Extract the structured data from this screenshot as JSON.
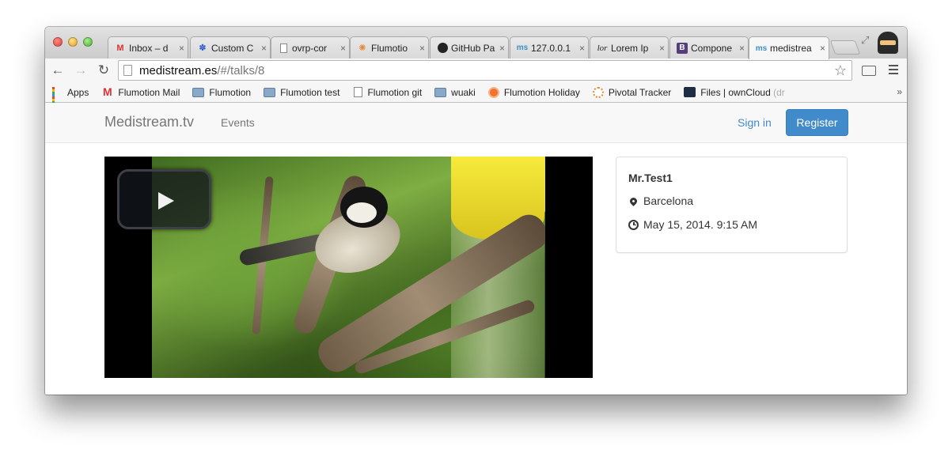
{
  "browser": {
    "tabs": [
      {
        "label": "Inbox – d",
        "favicon": "gmail-icon",
        "active": false
      },
      {
        "label": "Custom C",
        "favicon": "paw-icon",
        "active": false
      },
      {
        "label": "ovrp-cor",
        "favicon": "page-icon",
        "active": false
      },
      {
        "label": "Flumotio",
        "favicon": "pivotal-icon",
        "active": false
      },
      {
        "label": "GitHub Pa",
        "favicon": "github-icon",
        "active": false
      },
      {
        "label": "127.0.0.1",
        "favicon": "ms-icon",
        "active": false
      },
      {
        "label": "Lorem Ip",
        "favicon": "lorem-icon",
        "active": false
      },
      {
        "label": "Compone",
        "favicon": "bootstrap-icon",
        "active": false
      },
      {
        "label": "medistrea",
        "favicon": "ms-icon",
        "active": true
      }
    ],
    "address": {
      "host": "medistream.es",
      "path": "/#/talks/8"
    },
    "bookmarks": [
      {
        "label": "Apps",
        "icon": "apps-grid-icon"
      },
      {
        "label": "Flumotion Mail",
        "icon": "gmail-icon"
      },
      {
        "label": "Flumotion",
        "icon": "folder-icon"
      },
      {
        "label": "Flumotion test",
        "icon": "folder-icon"
      },
      {
        "label": "Flumotion git",
        "icon": "page-icon"
      },
      {
        "label": "wuaki",
        "icon": "folder-icon"
      },
      {
        "label": "Flumotion Holiday",
        "icon": "holiday-icon"
      },
      {
        "label": "Pivotal Tracker",
        "icon": "pivotal-icon"
      },
      {
        "label": "Files | ownCloud",
        "label_faded": "(dr",
        "icon": "owncloud-icon"
      }
    ],
    "bookmarks_more": "»",
    "close_glyph": "×"
  },
  "site": {
    "brand": "Medistream.tv",
    "nav_events": "Events",
    "sign_in": "Sign in",
    "register": "Register",
    "accent_color": "#428bca"
  },
  "talk": {
    "speaker": "Mr.Test1",
    "location": "Barcelona",
    "datetime": "May 15, 2014. 9:15 AM"
  }
}
